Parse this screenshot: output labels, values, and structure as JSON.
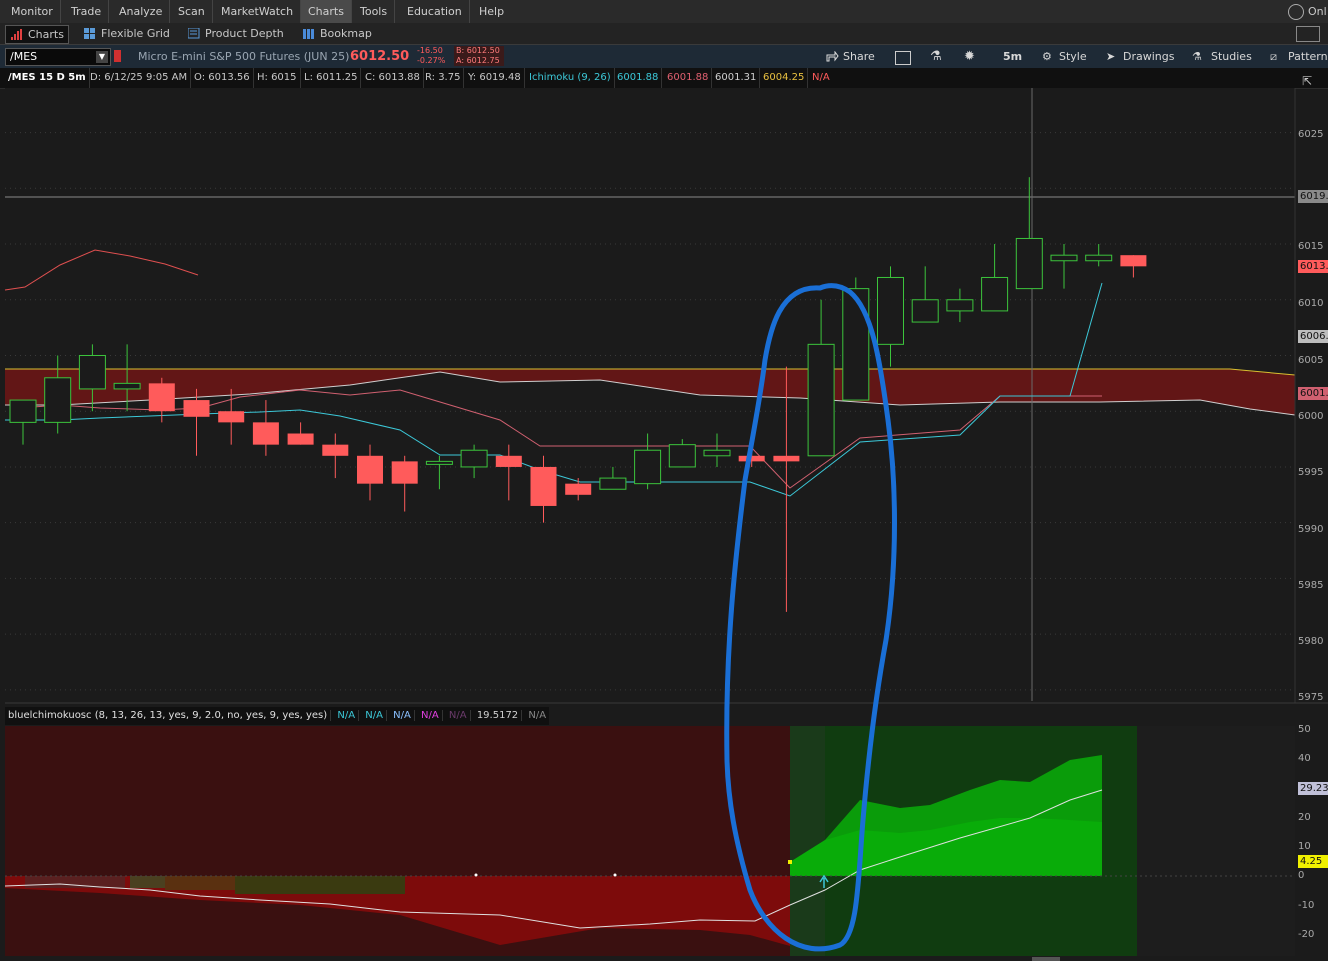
{
  "menu": {
    "items": [
      "Monitor",
      "Trade",
      "Analyze",
      "Scan",
      "MarketWatch",
      "Charts",
      "Tools",
      "Education",
      "Help"
    ],
    "active": "Charts",
    "right_label": "Onl"
  },
  "tabs": [
    {
      "label": "Charts",
      "active": true,
      "icon": "bar-chart-icon"
    },
    {
      "label": "Flexible Grid",
      "active": false,
      "icon": "grid-icon"
    },
    {
      "label": "Product Depth",
      "active": false,
      "icon": "depth-icon"
    },
    {
      "label": "Bookmap",
      "active": false,
      "icon": "bookmap-icon"
    }
  ],
  "toolbar": {
    "symbol": "/MES",
    "description": "Micro E-mini S&P 500 Futures (JUN 25)",
    "last_price": "6012.50",
    "change": "-16.50",
    "change_pct": "-0.27%",
    "bid": "B: 6012.50",
    "ask": "A: 6012.75",
    "share_label": "Share",
    "interval": "5m",
    "style_label": "Style",
    "drawings_label": "Drawings",
    "studies_label": "Studies",
    "patterns_label": "Patterns"
  },
  "info": {
    "title": "/MES 15 D 5m",
    "date": "D: 6/12/25 9:05 AM",
    "open": "O: 6013.56",
    "high": "H: 6015",
    "low": "L: 6011.25",
    "close": "C: 6013.88",
    "range": "R: 3.75",
    "y": "Y: 6019.48",
    "study": "Ichimoku (9, 26)",
    "v1": "6001.88",
    "v2": "6001.88",
    "v3": "6001.31",
    "v4": "6004.25",
    "v5": "N/A"
  },
  "price_axis": {
    "ticks": [
      "6025",
      "6019.",
      "6015",
      "6013.",
      "6010",
      "6006.",
      "6005",
      "6001.",
      "6000",
      "5995",
      "5990",
      "5985",
      "5980",
      "5975"
    ]
  },
  "oscillator": {
    "header": "bluelchimokuosc (8, 13, 26, 13, yes, 9, 2.0, no, yes, 9, yes, yes)",
    "values": [
      "N/A",
      "N/A",
      "N/A",
      "N/A",
      "N/A",
      "19.5172",
      "N/A"
    ],
    "ticks": [
      "50",
      "40",
      "29.23",
      "20",
      "10",
      "4.25",
      "0",
      "-10",
      "-20"
    ]
  },
  "colors": {
    "up": "#3cc43c",
    "down": "#ff5b5b",
    "cloud_red": "#6e1515",
    "osc_green": "#0a8c0a",
    "annotation": "#1a6fd6",
    "tenkan": "#3cc8d8",
    "kijun": "#d06070"
  },
  "chart_data": {
    "type": "candlestick",
    "ylim": [
      5974,
      6029
    ],
    "candles": [
      {
        "o": 5999,
        "h": 6001,
        "l": 5997,
        "c": 6001
      },
      {
        "o": 5999,
        "h": 6005,
        "l": 5998,
        "c": 6003
      },
      {
        "o": 6002,
        "h": 6006,
        "l": 6000,
        "c": 6005
      },
      {
        "o": 6002,
        "h": 6006,
        "l": 6000,
        "c": 6002.5
      },
      {
        "o": 6002.5,
        "h": 6003,
        "l": 5999,
        "c": 6000
      },
      {
        "o": 6001,
        "h": 6002,
        "l": 5996,
        "c": 5999.5
      },
      {
        "o": 6000,
        "h": 6002,
        "l": 5997,
        "c": 5999
      },
      {
        "o": 5999,
        "h": 6001,
        "l": 5996,
        "c": 5997
      },
      {
        "o": 5998,
        "h": 5999,
        "l": 5997,
        "c": 5997
      },
      {
        "o": 5997,
        "h": 5998,
        "l": 5994,
        "c": 5996
      },
      {
        "o": 5996,
        "h": 5997,
        "l": 5992,
        "c": 5993.5
      },
      {
        "o": 5995.5,
        "h": 5996,
        "l": 5991,
        "c": 5993.5
      },
      {
        "o": 5995.5,
        "h": 5996,
        "l": 5993,
        "c": 5995.5
      },
      {
        "o": 5995,
        "h": 5997,
        "l": 5994,
        "c": 5996.5
      },
      {
        "o": 5996,
        "h": 5997,
        "l": 5992,
        "c": 5995
      },
      {
        "o": 5995,
        "h": 5996,
        "l": 5990,
        "c": 5991.5
      },
      {
        "o": 5993.5,
        "h": 5994,
        "l": 5992,
        "c": 5992.5
      },
      {
        "o": 5993,
        "h": 5995,
        "l": 5993,
        "c": 5994
      },
      {
        "o": 5993.5,
        "h": 5998,
        "l": 5993,
        "c": 5996.5
      },
      {
        "o": 5995,
        "h": 5997.5,
        "l": 5995,
        "c": 5997
      },
      {
        "o": 5996,
        "h": 5998,
        "l": 5995,
        "c": 5996.5
      },
      {
        "o": 5996,
        "h": 5997,
        "l": 5995,
        "c": 5995.5
      },
      {
        "o": 5996,
        "h": 6004,
        "l": 5982,
        "c": 5995.5
      },
      {
        "o": 5996,
        "h": 6010,
        "l": 5996,
        "c": 6006
      },
      {
        "o": 6001,
        "h": 6012,
        "l": 6001,
        "c": 6011
      },
      {
        "o": 6006,
        "h": 6013,
        "l": 6004,
        "c": 6012
      },
      {
        "o": 6008,
        "h": 6013,
        "l": 6008,
        "c": 6010
      },
      {
        "o": 6009,
        "h": 6011,
        "l": 6008,
        "c": 6010
      },
      {
        "o": 6009,
        "h": 6015,
        "l": 6009,
        "c": 6012
      },
      {
        "o": 6011,
        "h": 6021,
        "l": 6011,
        "c": 6015.5
      },
      {
        "o": 6013.5,
        "h": 6015,
        "l": 6011,
        "c": 6014
      },
      {
        "o": 6013.5,
        "h": 6015,
        "l": 6013,
        "c": 6014
      },
      {
        "o": 6014,
        "h": 6014,
        "l": 6012,
        "c": 6013
      }
    ],
    "oscillator": {
      "ylim": [
        -26,
        53
      ]
    }
  }
}
